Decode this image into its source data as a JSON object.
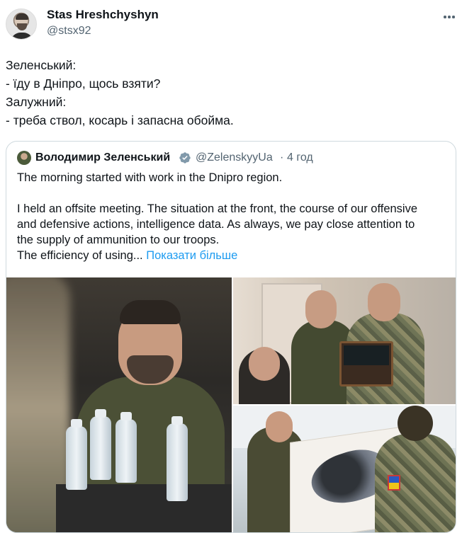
{
  "author": {
    "name": "Stas Hreshchyshyn",
    "handle": "@stsx92",
    "avatar_icon": "user-avatar"
  },
  "more_icon": "more-horizontal-icon",
  "tweet": {
    "lines": [
      "Зеленський:",
      "- їду в Дніпро, щось взяти?",
      "Залужний:",
      "- треба ствол, косарь і запасна обойма."
    ]
  },
  "quote": {
    "author_name": "Володимир Зеленський",
    "verified_icon": "verified-badge-icon",
    "handle": "@ZelenskyyUa",
    "separator": "·",
    "time": "4 год",
    "text_lines": [
      "The morning started with work in the Dnipro region.",
      "",
      "I held an offsite meeting. The situation at the front, the course of our offensive",
      "and defensive actions, intelligence data. As always, we pay close attention to",
      "the supply of ammunition to our troops.",
      "The efficiency of using..."
    ],
    "show_more": "Показати більше"
  },
  "media": {
    "count": 3,
    "accent_color": "#1d9bf0"
  },
  "colors": {
    "text": "#0f1419",
    "secondary": "#536471",
    "link": "#1d9bf0",
    "border": "#cfd9de",
    "verified": "#829aab"
  }
}
